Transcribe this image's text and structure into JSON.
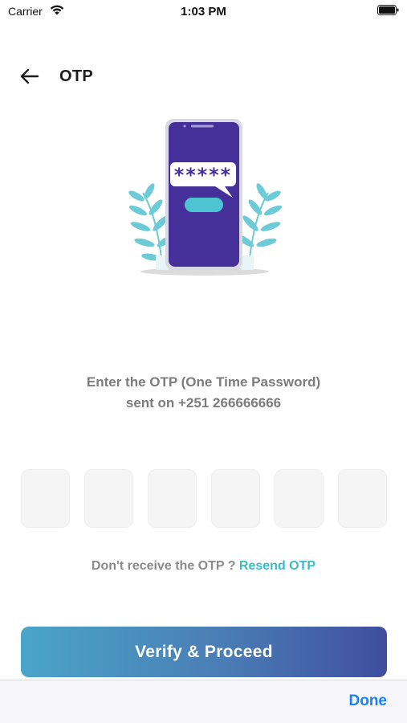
{
  "status_bar": {
    "carrier": "Carrier",
    "time": "1:03 PM"
  },
  "header": {
    "title": "OTP"
  },
  "illustration": {
    "message_text": "*****"
  },
  "instructions": {
    "line1": "Enter the OTP (One Time Password)",
    "line2": "sent on +251 266666666"
  },
  "otp": {
    "boxes": [
      "",
      "",
      "",
      "",
      "",
      ""
    ]
  },
  "resend": {
    "prompt": "Don't receive the OTP ? ",
    "link": "Resend OTP"
  },
  "verify": {
    "label": "Verify & Proceed"
  },
  "keyboard_toolbar": {
    "done_label": "Done"
  },
  "colors": {
    "accent": "#3bbbc8",
    "phone_body": "#45309a",
    "leaf": "#6ccbd6",
    "done": "#1e7ff0",
    "button_gradient_start": "#4aa5c9",
    "button_gradient_end": "#3f4ea0"
  }
}
